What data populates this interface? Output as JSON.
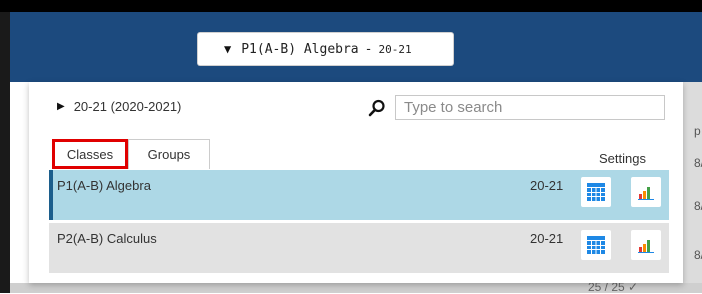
{
  "header": {
    "class_selector": {
      "caret": "▼",
      "class_name": "P1(A-B) Algebra",
      "separator": "-",
      "year": "20-21"
    }
  },
  "panel": {
    "year_toggle": {
      "label": "20-21 (2020-2021)",
      "expanded": false
    },
    "search": {
      "placeholder": "Type to search",
      "value": ""
    },
    "tabs": [
      {
        "label": "Classes",
        "active": true,
        "highlighted": true
      },
      {
        "label": "Groups",
        "active": false
      }
    ],
    "settings_label": "Settings",
    "rows": [
      {
        "name": "P1(A-B) Algebra",
        "year": "20-21",
        "selected": true
      },
      {
        "name": "P2(A-B) Calculus",
        "year": "20-21",
        "selected": false
      }
    ]
  },
  "background": {
    "right_peek": [
      "p",
      "8/",
      "8/",
      "8/"
    ],
    "bottom_peek": "25 / 25 ✓"
  },
  "colors": {
    "header": "#1c4a7e",
    "selected_row": "#add8e6",
    "selected_row_accent": "#1c5e8c",
    "row": "#e2e2e2",
    "highlight_box": "#e00000",
    "icon_blue": "#1e88e5"
  },
  "icons": {
    "search": "search-icon",
    "grid": "gradebook-grid-icon",
    "chart": "bar-chart-icon"
  }
}
